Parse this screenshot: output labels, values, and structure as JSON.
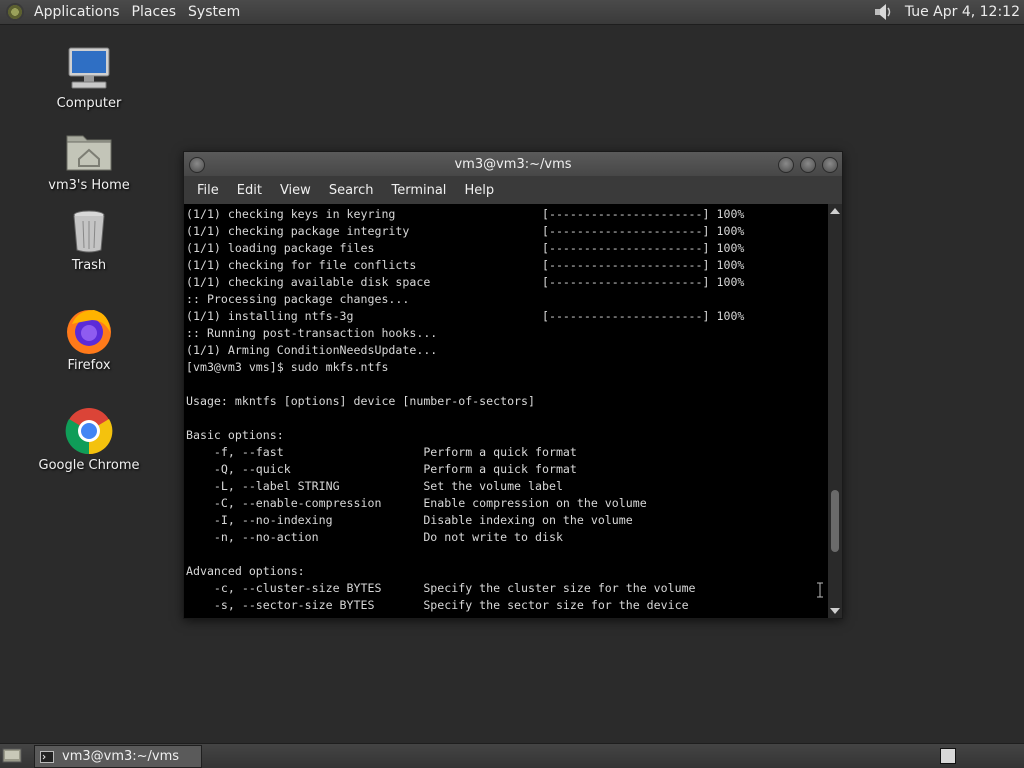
{
  "top_panel": {
    "menus": [
      "Applications",
      "Places",
      "System"
    ],
    "clock": "Tue Apr  4, 12:12"
  },
  "desktop": {
    "icons": [
      {
        "label": "Computer",
        "icon": "computer-icon"
      },
      {
        "label": "vm3's Home",
        "icon": "home-folder-icon"
      },
      {
        "label": "Trash",
        "icon": "trash-icon"
      },
      {
        "label": "Firefox",
        "icon": "firefox-icon"
      },
      {
        "label": "Google Chrome",
        "icon": "chrome-icon"
      }
    ]
  },
  "window": {
    "title": "vm3@vm3:~/vms",
    "menu": [
      "File",
      "Edit",
      "View",
      "Search",
      "Terminal",
      "Help"
    ],
    "terminal_lines": [
      "(1/1) checking keys in keyring                     [----------------------] 100%",
      "(1/1) checking package integrity                   [----------------------] 100%",
      "(1/1) loading package files                        [----------------------] 100%",
      "(1/1) checking for file conflicts                  [----------------------] 100%",
      "(1/1) checking available disk space                [----------------------] 100%",
      ":: Processing package changes...",
      "(1/1) installing ntfs-3g                           [----------------------] 100%",
      ":: Running post-transaction hooks...",
      "(1/1) Arming ConditionNeedsUpdate...",
      "[vm3@vm3 vms]$ sudo mkfs.ntfs",
      "",
      "Usage: mkntfs [options] device [number-of-sectors]",
      "",
      "Basic options:",
      "    -f, --fast                    Perform a quick format",
      "    -Q, --quick                   Perform a quick format",
      "    -L, --label STRING            Set the volume label",
      "    -C, --enable-compression      Enable compression on the volume",
      "    -I, --no-indexing             Disable indexing on the volume",
      "    -n, --no-action               Do not write to disk",
      "",
      "Advanced options:",
      "    -c, --cluster-size BYTES      Specify the cluster size for the volume",
      "    -s, --sector-size BYTES       Specify the sector size for the device"
    ]
  },
  "bottom_panel": {
    "task_label": "vm3@vm3:~/vms"
  }
}
